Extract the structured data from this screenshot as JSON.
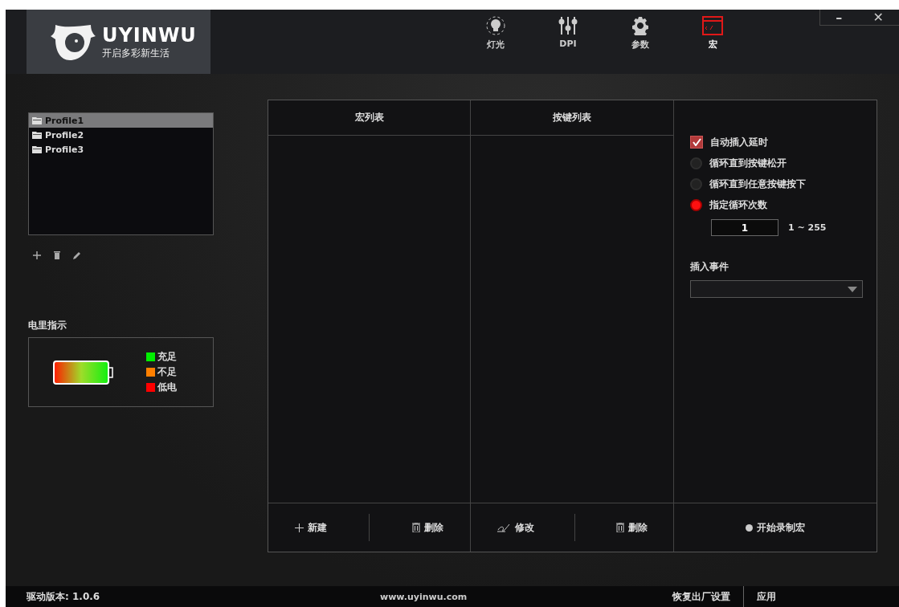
{
  "brand": {
    "name": "UYINWU",
    "slogan": "开启多彩新生活"
  },
  "nav": [
    {
      "label": "灯光",
      "kind": "bulb",
      "selected": false
    },
    {
      "label": "DPI",
      "kind": "sliders",
      "selected": false
    },
    {
      "label": "参数",
      "kind": "gear",
      "selected": false
    },
    {
      "label": "宏",
      "kind": "macro",
      "selected": true
    }
  ],
  "window_controls": [
    "–",
    "✕"
  ],
  "profiles": [
    {
      "label": "Profile1",
      "selected": true
    },
    {
      "label": "Profile2",
      "selected": false
    },
    {
      "label": "Profile3",
      "selected": false
    }
  ],
  "battery": {
    "title": "电里指示",
    "legend": [
      {
        "label": "充足",
        "color": "#00ee00"
      },
      {
        "label": "不足",
        "color": "#ff8000"
      },
      {
        "label": "低电",
        "color": "#ff0000"
      }
    ]
  },
  "macro_list": {
    "title": "宏列表",
    "actions": [
      {
        "label": "新建",
        "kind": "plus"
      },
      {
        "label": "删除",
        "kind": "trash"
      }
    ]
  },
  "key_list": {
    "title": "按键列表",
    "actions": [
      {
        "label": "修改",
        "kind": "edit"
      },
      {
        "label": "删除",
        "kind": "trash"
      }
    ]
  },
  "options": [
    {
      "kind": "checkbox",
      "label": "自动插入延时",
      "checked": true
    },
    {
      "kind": "radio",
      "label": "循环直到按键松开",
      "selected": false
    },
    {
      "kind": "radio",
      "label": "循环直到任意按键按下",
      "selected": false
    },
    {
      "kind": "radio",
      "label": "指定循环次数",
      "selected": true
    }
  ],
  "loop_count": {
    "value": "1",
    "range": "1 ~ 255"
  },
  "insert_event": {
    "label": "插入事件"
  },
  "record_button": "开始录制宏",
  "footer": {
    "version": "驱动版本: 1.0.6",
    "website": "www.uyinwu.com",
    "reset": "恢复出厂设置",
    "apply": "应用"
  }
}
